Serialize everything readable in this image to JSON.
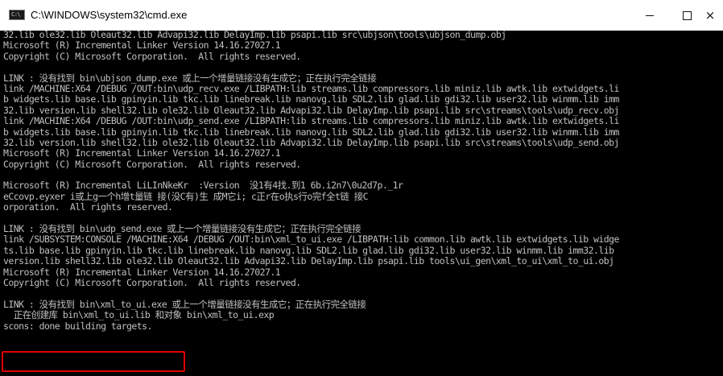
{
  "window": {
    "title": "C:\\WINDOWS\\system32\\cmd.exe",
    "icon_text": "C:\\",
    "buttons": {
      "minimize": "minimize-icon",
      "maximize": "maximize-icon",
      "close": "×"
    }
  },
  "colors": {
    "console_bg": "#000000",
    "console_fg": "#c0c0c0",
    "highlight": "#e00000"
  },
  "console": {
    "lines": [
      "32.lib ole32.lib Oleaut32.lib Advapi32.lib DelayImp.lib psapi.lib src\\ubjson\\tools\\ubjson_dump.obj",
      "Microsoft (R) Incremental Linker Version 14.16.27027.1",
      "Copyright (C) Microsoft Corporation.  All rights reserved.",
      "",
      "LINK : 没有找到 bin\\ubjson_dump.exe 或上一个增量链接没有生成它；正在执行完全链接",
      "link /MACHINE:X64 /DEBUG /OUT:bin\\udp_recv.exe /LIBPATH:lib streams.lib compressors.lib miniz.lib awtk.lib extwidgets.li",
      "b widgets.lib base.lib gpinyin.lib tkc.lib linebreak.lib nanovg.lib SDL2.lib glad.lib gdi32.lib user32.lib winmm.lib imm",
      "32.lib version.lib shell32.lib ole32.lib Oleaut32.lib Advapi32.lib DelayImp.lib psapi.lib src\\streams\\tools\\udp_recv.obj",
      "link /MACHINE:X64 /DEBUG /OUT:bin\\udp_send.exe /LIBPATH:lib streams.lib compressors.lib miniz.lib awtk.lib extwidgets.li",
      "b widgets.lib base.lib gpinyin.lib tkc.lib linebreak.lib nanovg.lib SDL2.lib glad.lib gdi32.lib user32.lib winmm.lib imm",
      "32.lib version.lib shell32.lib ole32.lib Oleaut32.lib Advapi32.lib DelayImp.lib psapi.lib src\\streams\\tools\\udp_send.obj",
      "Microsoft (R) Incremental Linker Version 14.16.27027.1",
      "Copyright (C) Microsoft Corporation.  All rights reserved.",
      "",
      "Microsoft (R) Incremental LiLInNkeKr  :Version  没1有4找.到1 6b.i2n7\\0u2d7p._1r",
      "eCcovp.eyxer i或上g一个h增t量链 接(没C有)生 成M它i; c正r在o执s行o完f全t链 接C",
      "orporation.  All rights reserved.",
      "",
      "LINK : 没有找到 bin\\udp_send.exe 或上一个增量链接没有生成它；正在执行完全链接",
      "link /SUBSYSTEM:CONSOLE /MACHINE:X64 /DEBUG /OUT:bin\\xml_to_ui.exe /LIBPATH:lib common.lib awtk.lib extwidgets.lib widge",
      "ts.lib base.lib gpinyin.lib tkc.lib linebreak.lib nanovg.lib SDL2.lib glad.lib gdi32.lib user32.lib winmm.lib imm32.lib",
      "version.lib shell32.lib ole32.lib Oleaut32.lib Advapi32.lib DelayImp.lib psapi.lib tools\\ui_gen\\xml_to_ui\\xml_to_ui.obj",
      "Microsoft (R) Incremental Linker Version 14.16.27027.1",
      "Copyright (C) Microsoft Corporation.  All rights reserved.",
      "",
      "LINK : 没有找到 bin\\xml_to_ui.exe 或上一个增量链接没有生成它；正在执行完全链接",
      "  正在创建库 bin\\xml_to_ui.lib 和对象 bin\\xml_to_ui.exp",
      "scons: done building targets."
    ]
  }
}
